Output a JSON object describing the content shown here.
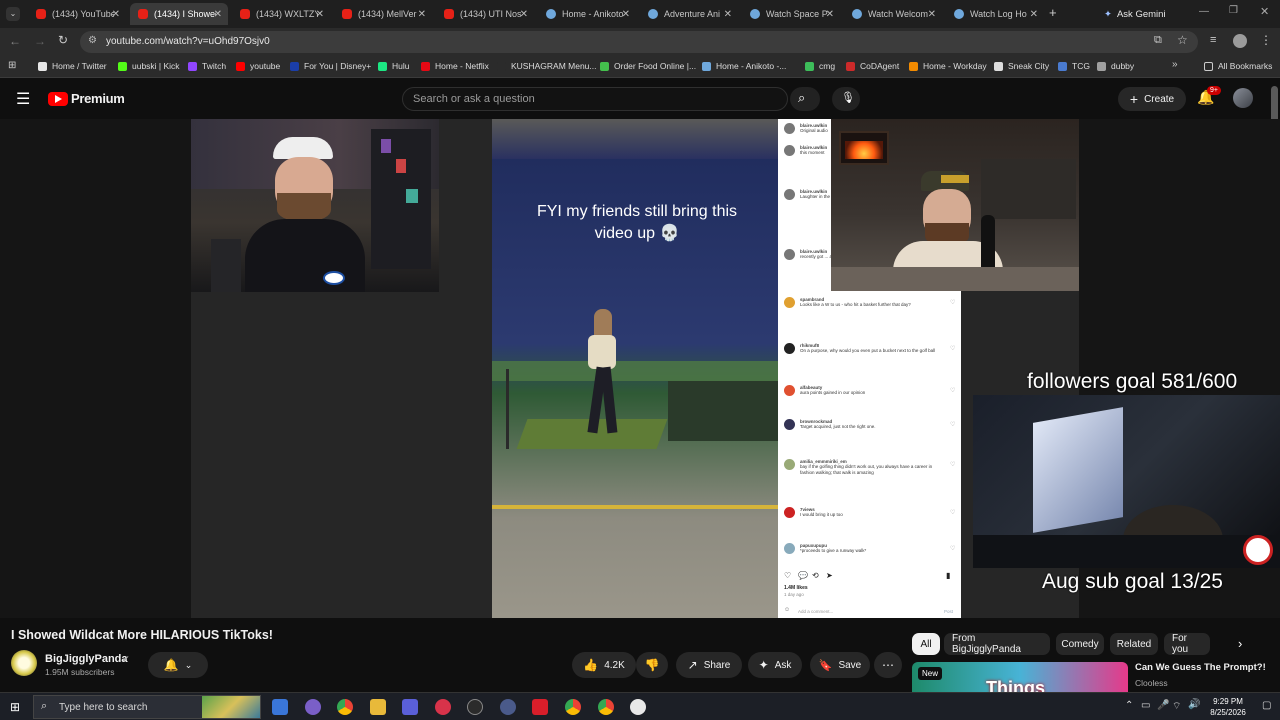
{
  "tabs": [
    {
      "label": "(1434) YouTube",
      "favicon": "youtube-icon",
      "active": false
    },
    {
      "label": "(1434) I Showed",
      "favicon": "youtube-icon",
      "active": true
    },
    {
      "label": "(1434) WXLTZY",
      "favicon": "youtube-icon",
      "active": false
    },
    {
      "label": "(1434) MellVer",
      "favicon": "youtube-icon",
      "active": false
    },
    {
      "label": "(1434) UTI Nos",
      "favicon": "youtube-icon",
      "active": false
    },
    {
      "label": "Home - Anikoto",
      "favicon": "globe-icon",
      "active": false
    },
    {
      "label": "Adventure Ani",
      "favicon": "globe-icon",
      "active": false
    },
    {
      "label": "Watch Space P",
      "favicon": "globe-icon",
      "active": false
    },
    {
      "label": "Watch Welcom",
      "favicon": "globe-icon",
      "active": false
    },
    {
      "label": "Watch Log Ho",
      "favicon": "globe-icon",
      "active": false
    }
  ],
  "browser": {
    "ask_gemini": "Ask Gemini",
    "url": "youtube.com/watch?v=uOhd97Osjv0",
    "all_bookmarks": "All Bookmarks",
    "bookmarks": [
      {
        "label": "Home / Twitter",
        "color": "#e7e7e7"
      },
      {
        "label": "uubski | Kick",
        "color": "#53fc18"
      },
      {
        "label": "Twitch",
        "color": "#9146ff"
      },
      {
        "label": "youtube",
        "color": "#ff0000"
      },
      {
        "label": "For You | Disney+",
        "color": "#1b3ea8"
      },
      {
        "label": "Hulu",
        "color": "#1ce783"
      },
      {
        "label": "Home - Netflix",
        "color": "#e50914"
      },
      {
        "label": "KUSHAGRAM Menu...",
        "color": "#2b2b2b"
      },
      {
        "label": "Order Food Online |...",
        "color": "#44c04d"
      },
      {
        "label": "Home - Anikoto -...",
        "color": "#6fa8dc"
      },
      {
        "label": "cmg",
        "color": "#3dbd5a"
      },
      {
        "label": "CoDAgent",
        "color": "#cc2a2a"
      },
      {
        "label": "Home - Workday",
        "color": "#f38b00"
      },
      {
        "label": "Sneak City",
        "color": "#dddddd"
      },
      {
        "label": "TCG",
        "color": "#4a7bd0"
      },
      {
        "label": "dubby",
        "color": "#a0a0a0"
      }
    ]
  },
  "youtube": {
    "logo_text": "Premium",
    "search_placeholder": "Search or ask a question",
    "create_label": "Create",
    "notification_badge": "9+"
  },
  "player": {
    "tiktok_caption": "FYI my friends still bring this video up 💀",
    "followers_goal": "followers goal 581/600",
    "sub_goal": "Aug sub goal 13/25",
    "comments": [
      {
        "user": "blaire.uwlkin",
        "text": "Original audio"
      },
      {
        "user": "blaire.uwlkin",
        "text": "this moment"
      },
      {
        "user": "blaire.uwlkin",
        "text": "Laughter in the there just ... swinging ... result with"
      },
      {
        "user": "blaire.uwlkin",
        "text": "recently got ... around and"
      },
      {
        "user": "spambrand",
        "text": "Looks like a W to us - who hit a basket further that day?"
      },
      {
        "user": "rhikmuf8",
        "text": "On a purpose, why would you even put a bucket next to the golf ball"
      },
      {
        "user": "alfabeauty",
        "text": "aura points gained in our opinion"
      },
      {
        "user": "brownrockmad",
        "text": "Target acquired, just not the right one."
      },
      {
        "user": "amilia_emmmiriki_em",
        "text": "bay if the golfing thing didn't work out, you always have a career in fashion walking; that walk is amazing"
      },
      {
        "user": "7views",
        "text": "I would bring it up too"
      },
      {
        "user": "papuxupupu",
        "text": "*proceeds to give a runway walk*"
      }
    ],
    "likes": "1.4M likes",
    "age": "1 day ago",
    "add_comment": "Add a comment...",
    "post_label": "Post"
  },
  "video_info": {
    "title": "I Showed Wildcat More HILARIOUS TikToks!",
    "channel": "BigJigglyPanda",
    "subscribers": "1.95M subscribers",
    "like_count": "4.2K",
    "share_label": "Share",
    "ask_label": "Ask",
    "save_label": "Save"
  },
  "chips": [
    "All",
    "From BigJigglyPanda",
    "Comedy",
    "Related",
    "For you"
  ],
  "recommended": {
    "badge": "New",
    "thumb_text": "Things",
    "title": "Can We Guess The Prompt?!",
    "channel": "Clooless"
  },
  "taskbar": {
    "search_placeholder": "Type here to search",
    "time": "9:29 PM",
    "date": "8/25/2026"
  }
}
